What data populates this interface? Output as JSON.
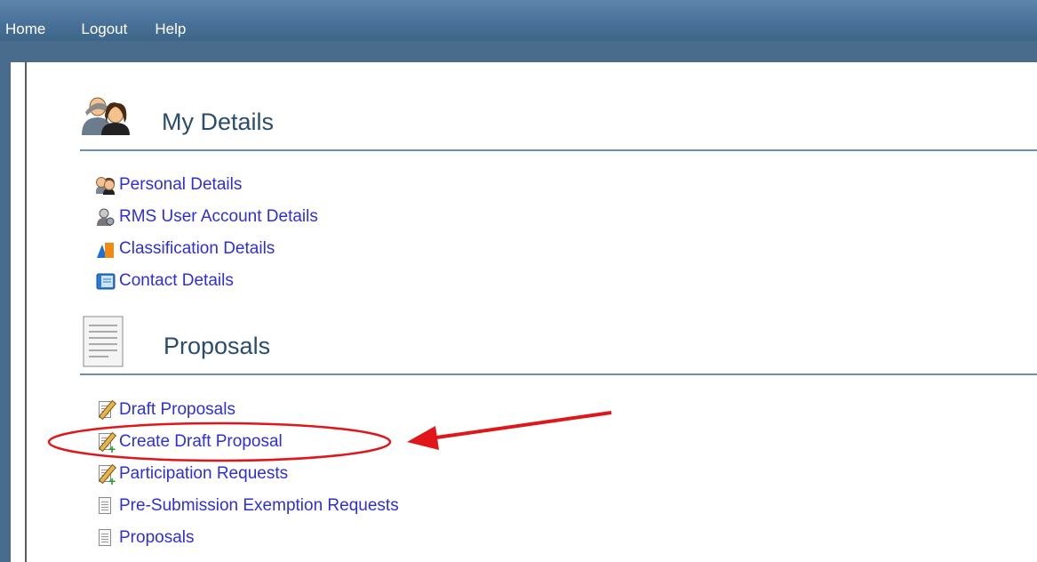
{
  "topnav": {
    "items": [
      "Home",
      "Logout",
      "Help"
    ]
  },
  "my_details": {
    "title": "My Details",
    "links": [
      "Personal Details",
      "RMS User Account Details",
      "Classification Details",
      "Contact Details"
    ]
  },
  "proposals": {
    "title": "Proposals",
    "links": [
      "Draft Proposals",
      "Create Draft Proposal",
      "Participation Requests",
      "Pre-Submission Exemption Requests",
      "Proposals"
    ]
  },
  "annotation": {
    "color": "#e0161a"
  }
}
